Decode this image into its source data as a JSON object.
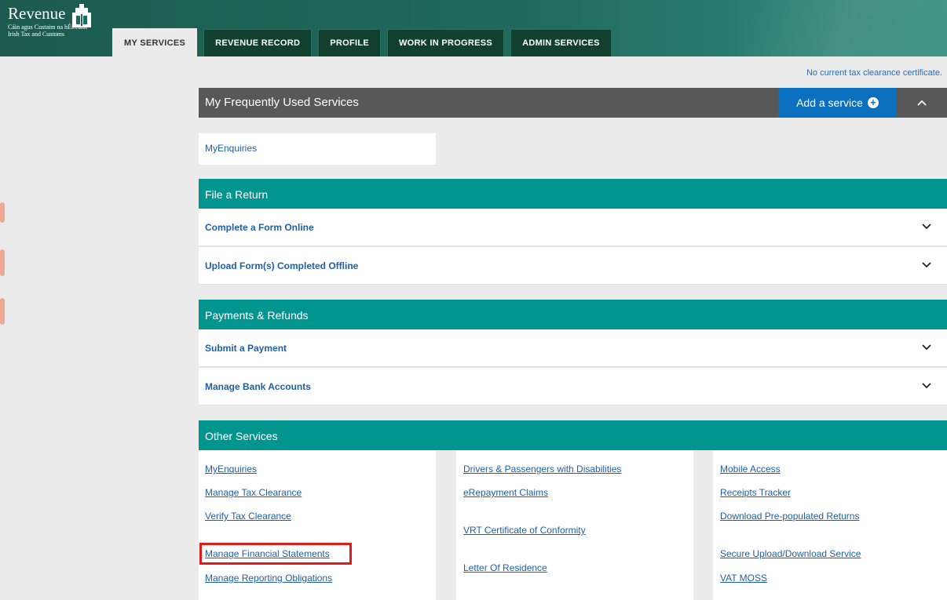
{
  "header": {
    "logo_title": "Revenue",
    "logo_subtitle_1": "Cáin agus Custaim na hÉireann",
    "logo_subtitle_2": "Irish Tax and Customs",
    "tabs": [
      "MY SERVICES",
      "REVENUE RECORD",
      "PROFILE",
      "WORK IN PROGRESS",
      "ADMIN SERVICES"
    ],
    "active_tab": "MY SERVICES"
  },
  "notice": "No current tax clearance certificate.",
  "frequent": {
    "title": "My Frequently Used Services",
    "add_service_label": "Add a service",
    "tiles": [
      "MyEnquiries"
    ]
  },
  "file_return": {
    "title": "File a Return",
    "items": [
      "Complete a Form Online",
      "Upload Form(s) Completed Offline"
    ]
  },
  "payments": {
    "title": "Payments & Refunds",
    "items": [
      "Submit a Payment",
      "Manage Bank Accounts"
    ]
  },
  "other": {
    "title": "Other Services",
    "col1": [
      "MyEnquiries",
      "Manage Tax Clearance",
      "Verify Tax Clearance",
      "Manage Financial Statements",
      "Manage Reporting Obligations"
    ],
    "col2": [
      "Drivers & Passengers with Disabilities",
      "eRepayment Claims",
      "VRT Certificate of Conformity",
      "Letter Of Residence"
    ],
    "col3": [
      "Mobile Access",
      "Receipts Tracker",
      "Download Pre-populated Returns",
      "Secure Upload/Download Service",
      "VAT MOSS"
    ],
    "highlighted": "Manage Financial Statements"
  },
  "colors": {
    "header_green": "#1f6a5d",
    "teal": "#00968f",
    "gray_bar": "#585858",
    "blue_button": "#0b6fc0",
    "link": "#1f5fa8",
    "highlight": "#e21b1b"
  },
  "icons": [
    "harp-logo-icon",
    "plus-circle-icon",
    "chevron-up-icon",
    "chevron-down-icon"
  ]
}
